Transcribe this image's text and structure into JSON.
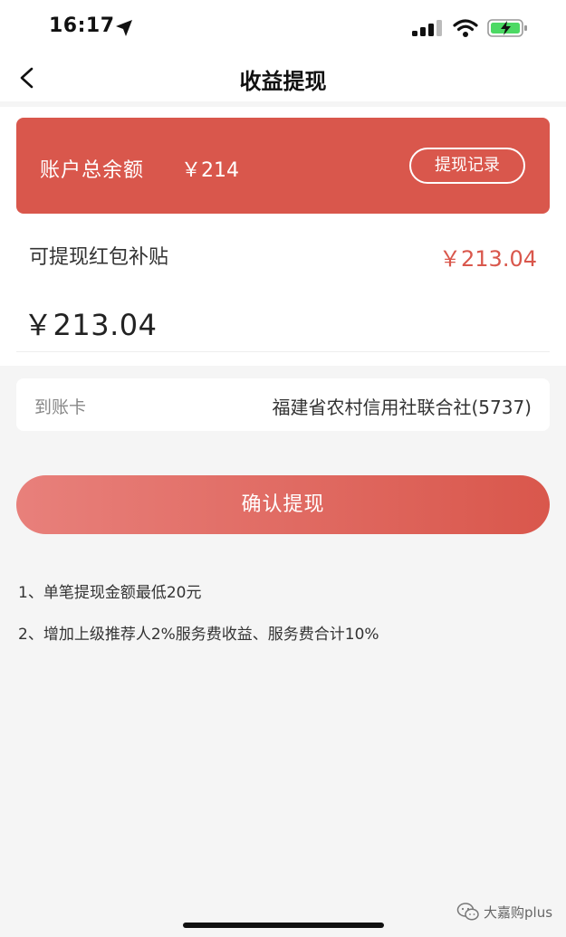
{
  "status_bar": {
    "time": "16:17",
    "icons": [
      "location-arrow-icon",
      "signal-icon",
      "wifi-icon",
      "battery-charging-icon"
    ]
  },
  "nav": {
    "back_icon": "chevron-left-icon",
    "title": "收益提现"
  },
  "balance_card": {
    "label": "账户总余额",
    "amount": "￥214",
    "record_button_label": "提现记录",
    "color": "#d9574c"
  },
  "subsidy": {
    "label": "可提现红包补贴",
    "amount": "￥213.04",
    "amount_color": "#d9574c"
  },
  "withdraw_input": {
    "value": "￥213.04"
  },
  "bank_card": {
    "label": "到账卡",
    "value": "福建省农村信用社联合社(5737)"
  },
  "confirm_button": {
    "label": "确认提现",
    "gradient_start": "#e8807b",
    "gradient_end": "#d9574c"
  },
  "notes": [
    "1、单笔提现金额最低20元",
    "2、增加上级推荐人2%服务费收益、服务费合计10%"
  ],
  "watermark": {
    "text": "大嘉购plus",
    "icon": "wechat-icon"
  }
}
